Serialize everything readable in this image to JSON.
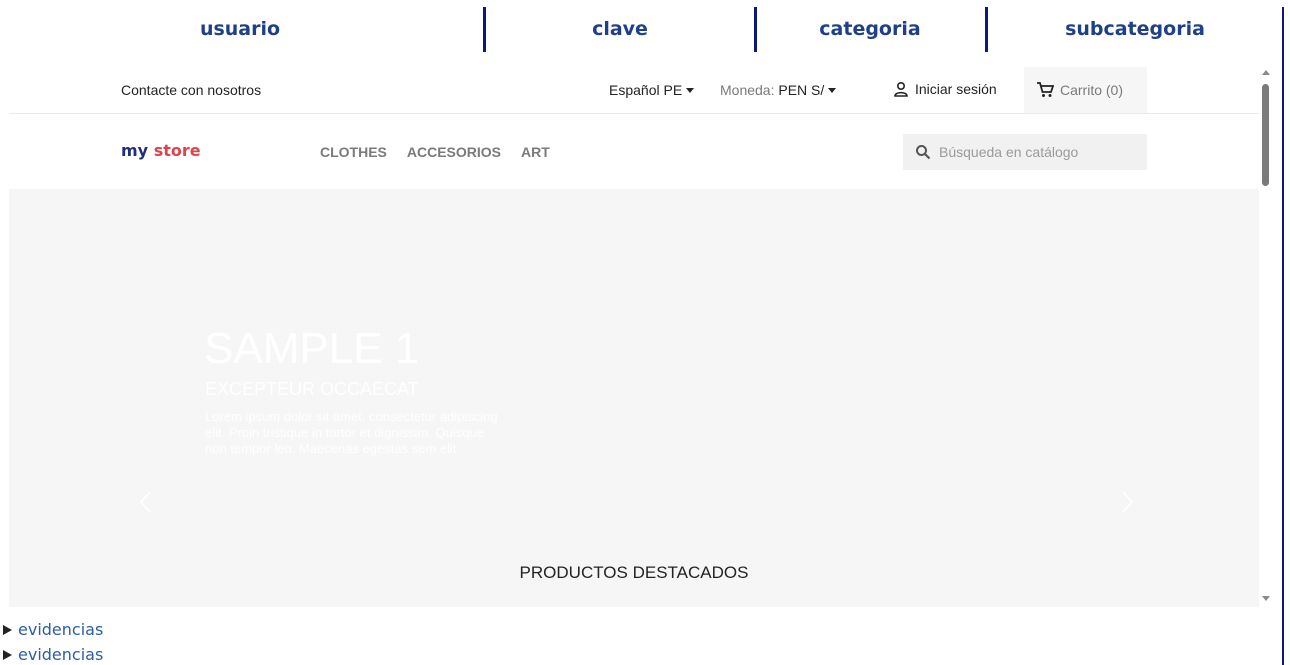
{
  "report_header": {
    "columns": [
      "usuario",
      "clave",
      "categoria",
      "subcategoria"
    ]
  },
  "site": {
    "top_nav": {
      "contact": "Contacte con nosotros",
      "language": "Español PE",
      "currency_label": "Moneda:",
      "currency_value": "PEN S/",
      "signin": "Iniciar sesión",
      "cart": "Carrito (0)"
    },
    "logo": {
      "part1": "my",
      "part2": "store"
    },
    "menu": [
      "CLOTHES",
      "ACCESORIOS",
      "ART"
    ],
    "search_placeholder": "Búsqueda en catálogo",
    "hero": {
      "title": "SAMPLE 1",
      "subtitle": "EXCEPTEUR OCCAECAT",
      "text": "Lorem ipsum dolor sit amet, consectetur adipiscing elit. Proin tristique in tortor et dignissim. Quisque non tempor leo. Maecenas egestas sem elit"
    },
    "featured_heading": "PRODUCTOS DESTACADOS"
  },
  "details": [
    {
      "label": "evidencias"
    },
    {
      "label": "evidencias"
    }
  ],
  "colors": {
    "header_text": "#1f3f8a",
    "separator": "#0a1a7a",
    "link": "#2a5ea8"
  }
}
